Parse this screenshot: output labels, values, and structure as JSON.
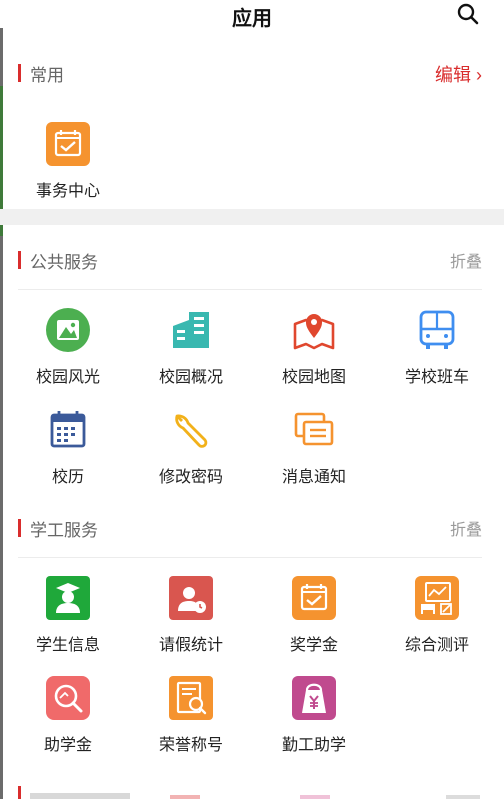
{
  "header": {
    "title": "应用"
  },
  "sections": {
    "common": {
      "title": "常用",
      "action": "编辑 ›",
      "apps": [
        {
          "name": "事务中心",
          "icon": "task-calendar-icon"
        }
      ]
    },
    "public": {
      "title": "公共服务",
      "action": "折叠",
      "apps": [
        {
          "name": "校园风光",
          "icon": "landscape-icon"
        },
        {
          "name": "校园概况",
          "icon": "buildings-icon"
        },
        {
          "name": "校园地图",
          "icon": "map-pin-icon"
        },
        {
          "name": "学校班车",
          "icon": "bus-icon"
        },
        {
          "name": "校历",
          "icon": "calendar-icon"
        },
        {
          "name": "修改密码",
          "icon": "wrench-icon"
        },
        {
          "name": "消息通知",
          "icon": "message-stack-icon"
        }
      ]
    },
    "student": {
      "title": "学工服务",
      "action": "折叠",
      "apps": [
        {
          "name": "学生信息",
          "icon": "graduate-icon"
        },
        {
          "name": "请假统计",
          "icon": "leave-clock-icon"
        },
        {
          "name": "奖学金",
          "icon": "award-calendar-icon"
        },
        {
          "name": "综合测评",
          "icon": "evaluation-chart-icon"
        },
        {
          "name": "助学金",
          "icon": "search-doc-icon"
        },
        {
          "name": "荣誉称号",
          "icon": "honor-doc-icon"
        },
        {
          "name": "勤工助学",
          "icon": "yen-bag-icon"
        }
      ]
    }
  },
  "colors": {
    "accent_red": "#d92d2d",
    "orange": "#f5932f",
    "green": "#4caf50",
    "teal": "#39b8b0",
    "blue": "#3f8ef0",
    "navy": "#3b5a9a"
  }
}
